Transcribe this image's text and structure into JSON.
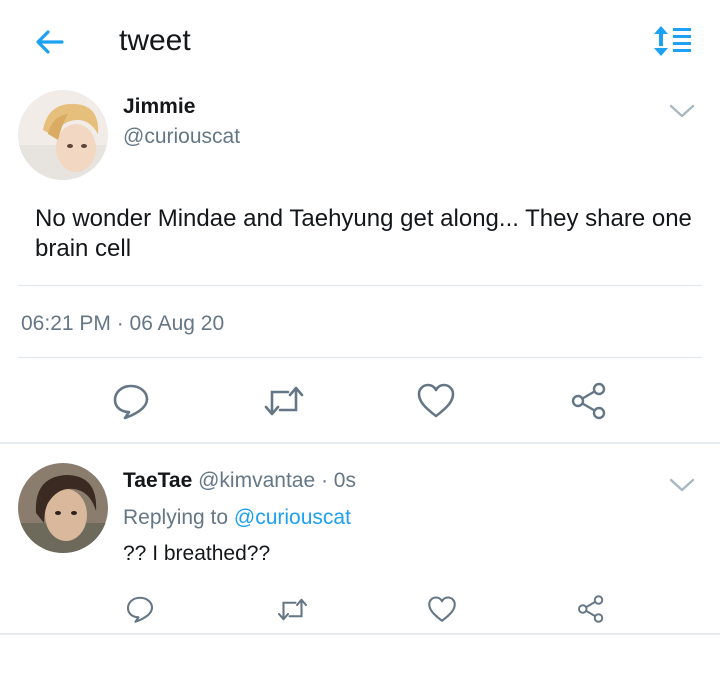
{
  "header": {
    "title": "tweet",
    "back_icon": "back-arrow-icon",
    "sort_icon": "sort-icon",
    "accent_color": "#1da1f2"
  },
  "main_tweet": {
    "name": "Jimmie",
    "handle": "@curiouscat",
    "text": "No wonder Mindae and Taehyung get along... They share one brain cell",
    "timestamp": "06:21 PM · 06 Aug 20",
    "actions": [
      "reply-icon",
      "retweet-icon",
      "like-icon",
      "share-icon"
    ]
  },
  "reply_tweet": {
    "name": "TaeTae",
    "handle": "@kimvantae",
    "time": "· 0s",
    "replying_to_label": "Replying to",
    "replying_to_handle": "@curiouscat",
    "text": "?? I breathed??",
    "actions": [
      "reply-icon",
      "retweet-icon",
      "like-icon",
      "share-icon"
    ]
  }
}
